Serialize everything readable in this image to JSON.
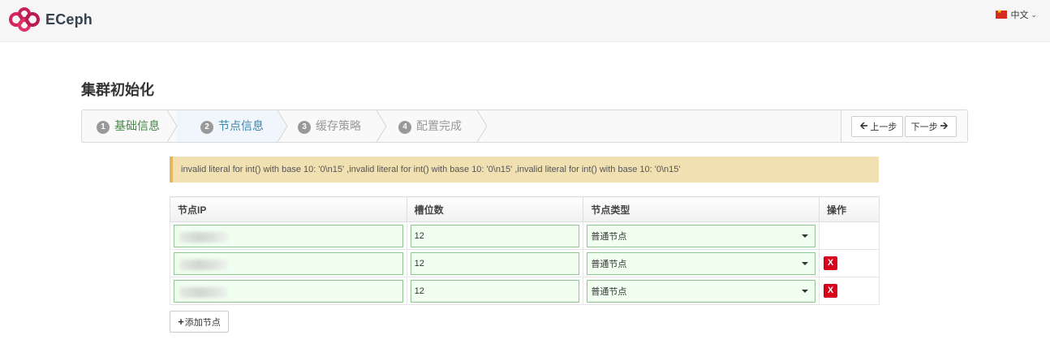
{
  "header": {
    "brand": "ECeph",
    "language": "中文"
  },
  "page": {
    "title": "集群初始化"
  },
  "wizard": {
    "steps": [
      {
        "num": "1",
        "label": "基础信息"
      },
      {
        "num": "2",
        "label": "节点信息"
      },
      {
        "num": "3",
        "label": "缓存策略"
      },
      {
        "num": "4",
        "label": "配置完成"
      }
    ],
    "prev_label": "上一步",
    "next_label": "下一步"
  },
  "alert": {
    "message": "invalid literal for int() with base 10: '0\\n15' ,invalid literal for int() with base 10: '0\\n15' ,invalid literal for int() with base 10: '0\\n15'"
  },
  "table": {
    "headers": [
      "节点IP",
      "槽位数",
      "节点类型",
      "操作"
    ],
    "rows": [
      {
        "ip": "",
        "slots": "12",
        "type": "普通节点",
        "action": ""
      },
      {
        "ip": "",
        "slots": "12",
        "type": "普通节点",
        "action": "X"
      },
      {
        "ip": "",
        "slots": "12",
        "type": "普通节点",
        "action": "X"
      }
    ]
  },
  "add_node_label": "添加节点",
  "colors": {
    "brand_red": "#d6245a",
    "step_done": "#468847",
    "step_active": "#3a87ad",
    "alert_bg": "#f1e0b2",
    "delete_red": "#d9001b",
    "input_border": "#8fc58f"
  }
}
